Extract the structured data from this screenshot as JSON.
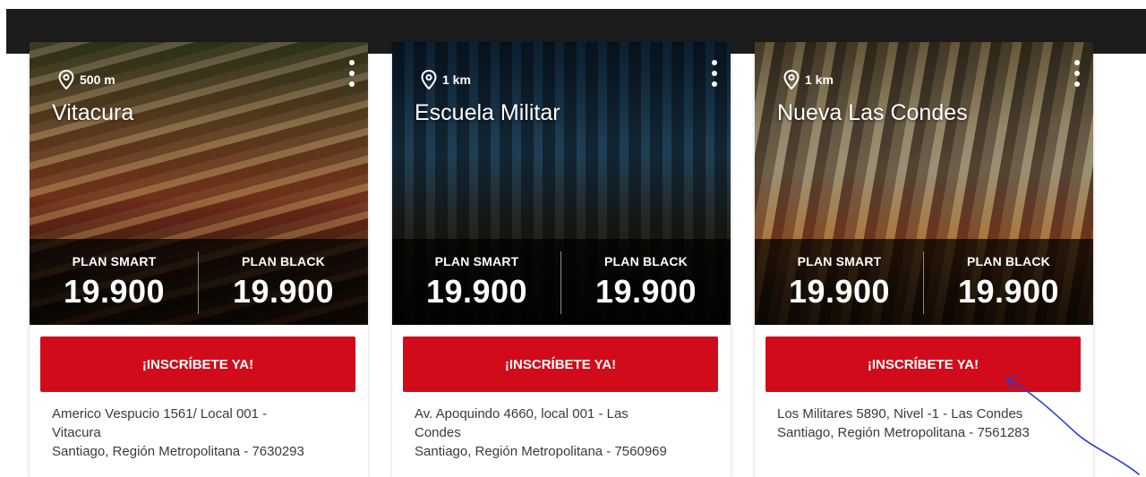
{
  "cards": [
    {
      "distance": "500 m",
      "name": "Vitacura",
      "plans": [
        {
          "label": "PLAN SMART",
          "price": "19.900"
        },
        {
          "label": "PLAN BLACK",
          "price": "19.900"
        }
      ],
      "cta": "¡INSCRÍBETE YA!",
      "address_lines": [
        "Americo Vespucio 1561/ Local 001 -",
        "Vitacura",
        "Santiago, Región Metropolitana - 7630293"
      ]
    },
    {
      "distance": "1 km",
      "name": "Escuela Militar",
      "plans": [
        {
          "label": "PLAN SMART",
          "price": "19.900"
        },
        {
          "label": "PLAN BLACK",
          "price": "19.900"
        }
      ],
      "cta": "¡INSCRÍBETE YA!",
      "address_lines": [
        "Av. Apoquindo 4660, local 001 - Las",
        "Condes",
        "Santiago, Región Metropolitana - 7560969"
      ]
    },
    {
      "distance": "1 km",
      "name": "Nueva Las Condes",
      "plans": [
        {
          "label": "PLAN SMART",
          "price": "19.900"
        },
        {
          "label": "PLAN BLACK",
          "price": "19.900"
        }
      ],
      "cta": "¡INSCRÍBETE YA!",
      "address_lines": [
        "Los Militares 5890, Nivel -1 - Las Condes",
        "Santiago, Región Metropolitana - 7561283"
      ]
    }
  ],
  "icons": {
    "location": "map-pin-icon",
    "menu": "more-vertical-icon"
  },
  "colors": {
    "topbar": "#1c1c1c",
    "cta": "#d20b1a",
    "annotation": "#2a3bd6"
  }
}
